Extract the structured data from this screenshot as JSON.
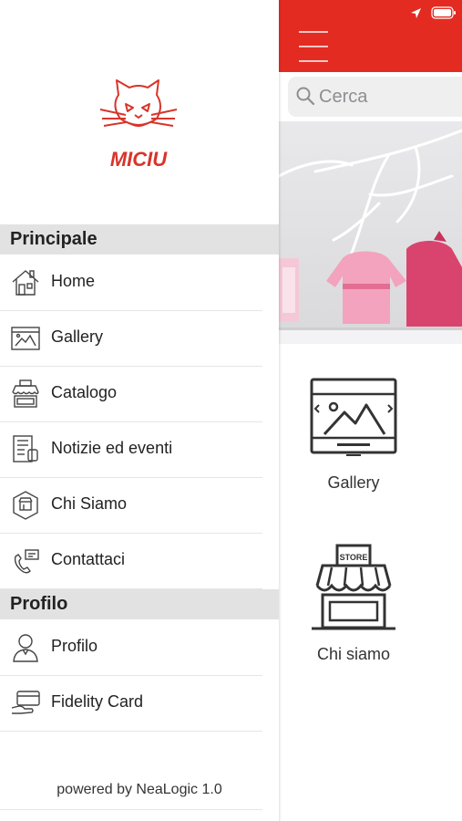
{
  "drawer": {
    "logo_text": "MICIU",
    "sections": [
      {
        "title": "Principale",
        "items": [
          {
            "label": "Home",
            "icon": "home-icon"
          },
          {
            "label": "Gallery",
            "icon": "gallery-icon"
          },
          {
            "label": "Catalogo",
            "icon": "store-icon"
          },
          {
            "label": "Notizie ed eventi",
            "icon": "news-icon"
          },
          {
            "label": "Chi Siamo",
            "icon": "about-icon"
          },
          {
            "label": "Contattaci",
            "icon": "contact-icon"
          }
        ]
      },
      {
        "title": "Profilo",
        "items": [
          {
            "label": "Profilo",
            "icon": "user-icon"
          },
          {
            "label": "Fidelity Card",
            "icon": "card-icon"
          }
        ]
      }
    ],
    "powered_by": "powered by NeaLogic 1.0"
  },
  "app": {
    "search": {
      "placeholder": "Cerca"
    },
    "tiles": [
      {
        "label": "Gallery",
        "icon": "gallery-icon"
      },
      {
        "label": "Chi siamo",
        "icon": "store-icon",
        "sign": "STORE"
      }
    ],
    "colors": {
      "accent": "#e32b22",
      "logo": "#d8342a"
    }
  }
}
